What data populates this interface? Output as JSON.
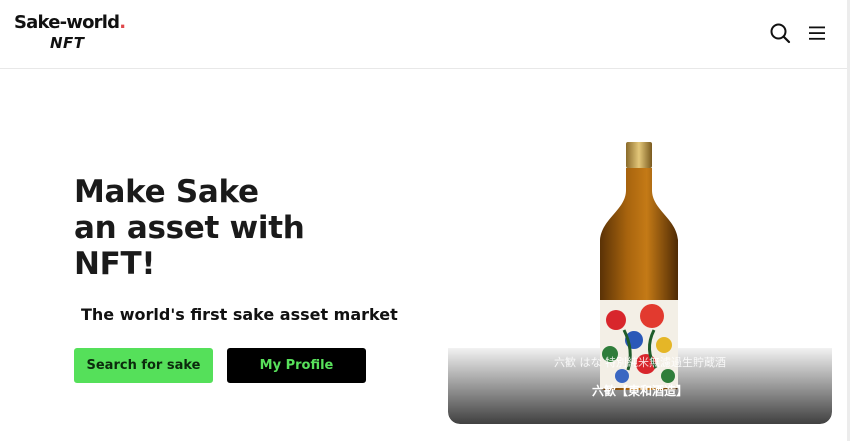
{
  "header": {
    "logo_main": "Sake-world",
    "logo_dot": ".",
    "logo_sub": "NFT",
    "search_icon": "search-icon",
    "menu_icon": "hamburger-menu-icon"
  },
  "hero": {
    "headline_line1": "Make Sake",
    "headline_line2": "an asset with",
    "headline_line3": "NFT!",
    "tagline": "The world's first sake asset market",
    "search_button_label": "Search for sake",
    "profile_button_label": "My Profile"
  },
  "featured": {
    "subtitle": "六歓 はな 特別純米無濾過生貯蔵酒",
    "title": "六歓【東和酒造】"
  },
  "colors": {
    "accent_green": "#55e05a",
    "logo_dot_red": "#e0484c",
    "profile_button_bg": "#000000"
  }
}
